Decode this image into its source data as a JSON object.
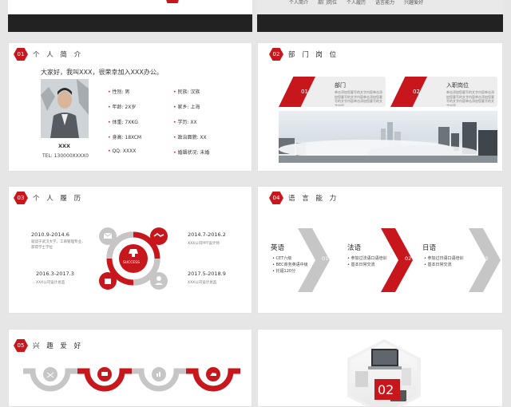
{
  "top_nav": {
    "items": [
      "个人简介",
      "部门岗位",
      "个人履历",
      "语言能力",
      "兴趣爱好"
    ]
  },
  "slide_intro": {
    "badge": "01",
    "title": "个 人 简 介",
    "greeting": "大家好，我叫XXX，很荣幸加入XXX办公。",
    "name": "XXX",
    "tel": "TEL: 130000XXXX0",
    "fields_left": [
      {
        "label": "性别:",
        "value": "男"
      },
      {
        "label": "年龄:",
        "value": "2X岁"
      },
      {
        "label": "体重:",
        "value": "7XKG"
      },
      {
        "label": "身高:",
        "value": "18XCM"
      },
      {
        "label": "QQ:",
        "value": "XXXX"
      }
    ],
    "fields_right": [
      {
        "label": "民族:",
        "value": "汉族"
      },
      {
        "label": "家乡:",
        "value": "上海"
      },
      {
        "label": "学历:",
        "value": "XX"
      },
      {
        "label": "政治面貌:",
        "value": "XX"
      },
      {
        "label": "婚姻状况:",
        "value": "未婚"
      }
    ]
  },
  "slide_dept": {
    "badge": "02",
    "title": "部 门 岗 位",
    "cards": [
      {
        "num": "01",
        "title": "部门",
        "desc": "单击添加您要写的文字内容单击添加您要写的文字内容单击添加您要写的文字内容单击添加您要写的文字内容"
      },
      {
        "num": "02",
        "title": "入职岗位",
        "desc": "单击添加您要写的文字内容单击添加您要写的文字内容单击添加您要写的文字内容单击添加您要写的文字内容"
      }
    ]
  },
  "slide_resume": {
    "badge": "03",
    "title": "个 人 履 历",
    "center_label": "SUCCESS",
    "entries": [
      {
        "date": "2010.9-2014.6",
        "desc": "就读于武汉大学，工商管理专业，获得学士学位"
      },
      {
        "date": "2014.7-2016.2",
        "desc": "XXX公司PPT设计师"
      },
      {
        "date": "2016.3-2017.3",
        "desc": "XXX公司设计总监"
      },
      {
        "date": "2017.5-2018.9",
        "desc": "XXX公司设计总监"
      }
    ]
  },
  "slide_lang": {
    "badge": "04",
    "title": "语 言 能 力",
    "items": [
      {
        "name": "英语",
        "num": "01",
        "points": [
          "CET六级",
          "BEC商务英语中级",
          "托福120分"
        ]
      },
      {
        "name": "法语",
        "num": "02",
        "points": [
          "参加过法语口语培训",
          "基本日常交流"
        ]
      },
      {
        "name": "日语",
        "num": "03",
        "points": [
          "参加过日语口语培训",
          "基本日常交流"
        ]
      }
    ]
  },
  "slide_hobby": {
    "badge": "05",
    "title": "兴 趣 爱 好"
  },
  "slide_section": {
    "num": "02"
  },
  "colors": {
    "accent": "#c8161d",
    "gray": "#c6c6c6",
    "dark": "#333333"
  }
}
